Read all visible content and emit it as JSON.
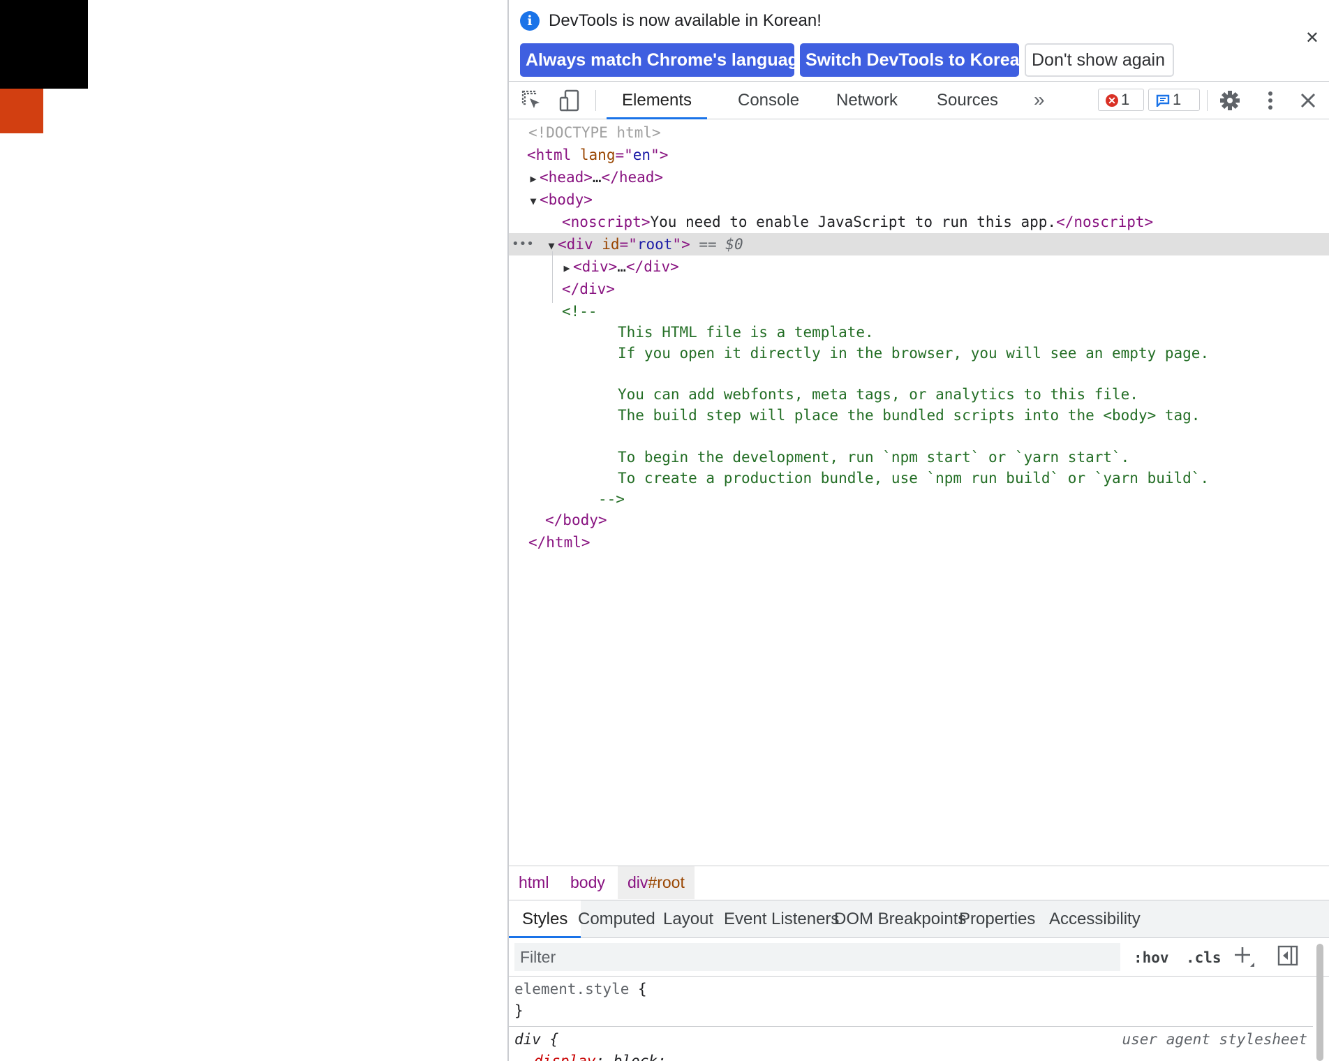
{
  "colors": {
    "page_black_box": "#000000",
    "page_red_box": "#d23f11",
    "infobar_primary_button": "#3f5fe0",
    "accent": "#1a73e8",
    "tag": "#881280",
    "attr_name": "#994500",
    "attr_value": "#1a1aa6",
    "comment": "#236e25"
  },
  "infobar": {
    "icon": "info-icon",
    "message": "DevTools is now available in Korean!",
    "buttons": {
      "match": "Always match Chrome's language",
      "switch": "Switch DevTools to Korean",
      "dont_show": "Don't show again"
    },
    "close_icon": "close-icon"
  },
  "toolbar": {
    "tabs": [
      "Elements",
      "Console",
      "Network",
      "Sources"
    ],
    "more_tabs": "»",
    "error_count": "1",
    "message_count": "1"
  },
  "tree": {
    "doctype": "<!DOCTYPE html>",
    "html_open_tag": "html",
    "html_lang_attr": "lang",
    "html_lang_value": "en",
    "head_tag": "head",
    "ellipsis": "…",
    "body_tag": "body",
    "noscript_tag": "noscript",
    "noscript_text": "You need to enable JavaScript to run this app.",
    "div_tag": "div",
    "root_attr": "id",
    "root_value": "root",
    "selected_marker": "== $0",
    "row_ellipsis": "•••",
    "comment_open": "<!--",
    "comment_lines": [
      "This HTML file is a template.",
      "If you open it directly in the browser, you will see an empty page.",
      "",
      "You can add webfonts, meta tags, or analytics to this file.",
      "The build step will place the bundled scripts into the <body> tag.",
      "",
      "To begin the development, run `npm start` or `yarn start`.",
      "To create a production bundle, use `npm run build` or `yarn build`."
    ],
    "comment_close": "-->"
  },
  "breadcrumb": {
    "html": "html",
    "body": "body",
    "div_tag": "div",
    "div_id": "#root"
  },
  "subtabs": [
    "Styles",
    "Computed",
    "Layout",
    "Event Listeners",
    "DOM Breakpoints",
    "Properties",
    "Accessibility"
  ],
  "filter": {
    "placeholder": "Filter",
    "hov": ":hov",
    "cls": ".cls"
  },
  "styles": {
    "element_style_selector": "element.style",
    "open_brace": " {",
    "close_brace": "}",
    "div_selector": "div",
    "ua_label": "user agent stylesheet",
    "prop_name": "display",
    "prop_value": "block"
  }
}
